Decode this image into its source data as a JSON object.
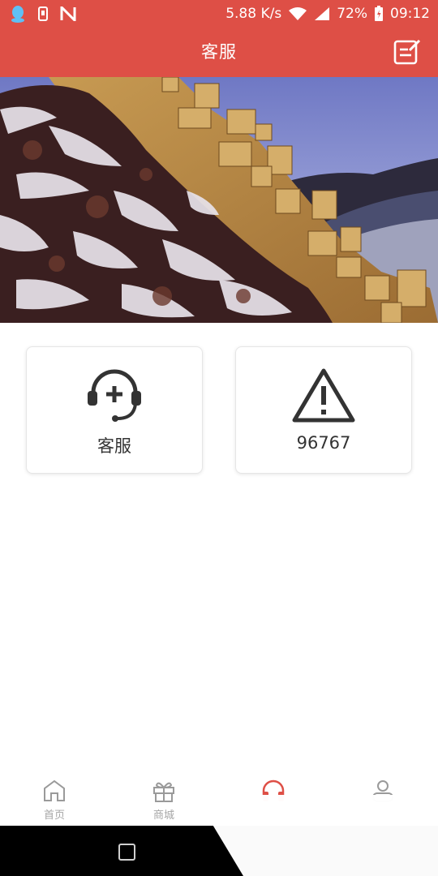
{
  "status_bar": {
    "network_speed": "5.88 K/s",
    "battery": "72%",
    "time": "09:12",
    "icons": [
      "qq-icon",
      "sim-icon",
      "n-icon",
      "wifi-icon",
      "signal-icon",
      "battery-icon"
    ]
  },
  "header": {
    "title": "客服",
    "edit_icon": "edit-note-icon"
  },
  "banner": {
    "image": "great-wall-winter"
  },
  "cards": [
    {
      "icon": "headset-plus-icon",
      "label": "客服"
    },
    {
      "icon": "warning-triangle-icon",
      "label": "96767"
    }
  ],
  "tabbar": {
    "items": [
      {
        "label": "首页",
        "icon": "home-icon",
        "active": false
      },
      {
        "label": "商城",
        "icon": "gift-icon",
        "active": false
      },
      {
        "label": "",
        "icon": "headphones-icon",
        "active": true
      },
      {
        "label": "",
        "icon": "user-icon",
        "active": false
      }
    ],
    "active_color": "#de4f46",
    "inactive_color": "#a6a6a6"
  },
  "colors": {
    "primary": "#de4f46"
  }
}
